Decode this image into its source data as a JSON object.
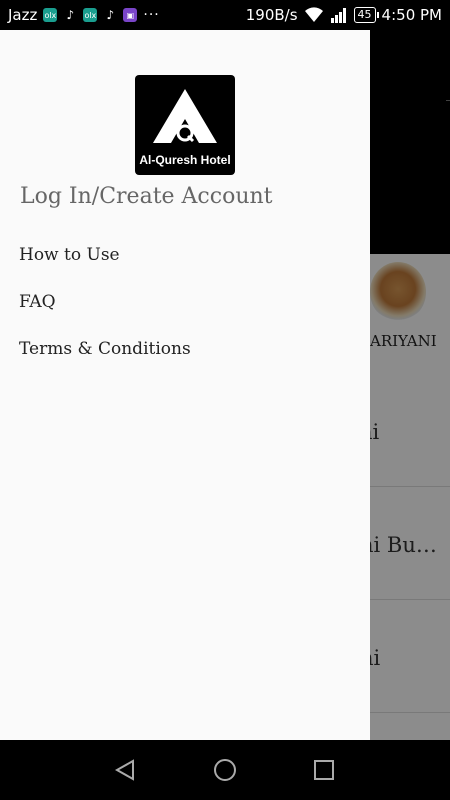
{
  "status_bar": {
    "carrier": "Jazz",
    "notification_icons": [
      "olx-icon",
      "tiktok-icon",
      "olx-icon",
      "tiktok-icon",
      "gallery-icon"
    ],
    "more": "···",
    "network_speed": "190B/s",
    "battery": "45",
    "time": "4:50 PM"
  },
  "drawer": {
    "logo_text": "Al-Quresh Hotel",
    "login_label": "Log In/Create Account",
    "menu": [
      {
        "label": "How to Use"
      },
      {
        "label": "FAQ"
      },
      {
        "label": "Terms & Conditions"
      }
    ]
  },
  "background": {
    "category_label": "ARIYANI",
    "items": [
      "ai",
      "hi Bu…",
      "ni"
    ]
  },
  "nav_bar": {
    "icons": [
      "back-icon",
      "home-icon",
      "recents-icon"
    ]
  }
}
